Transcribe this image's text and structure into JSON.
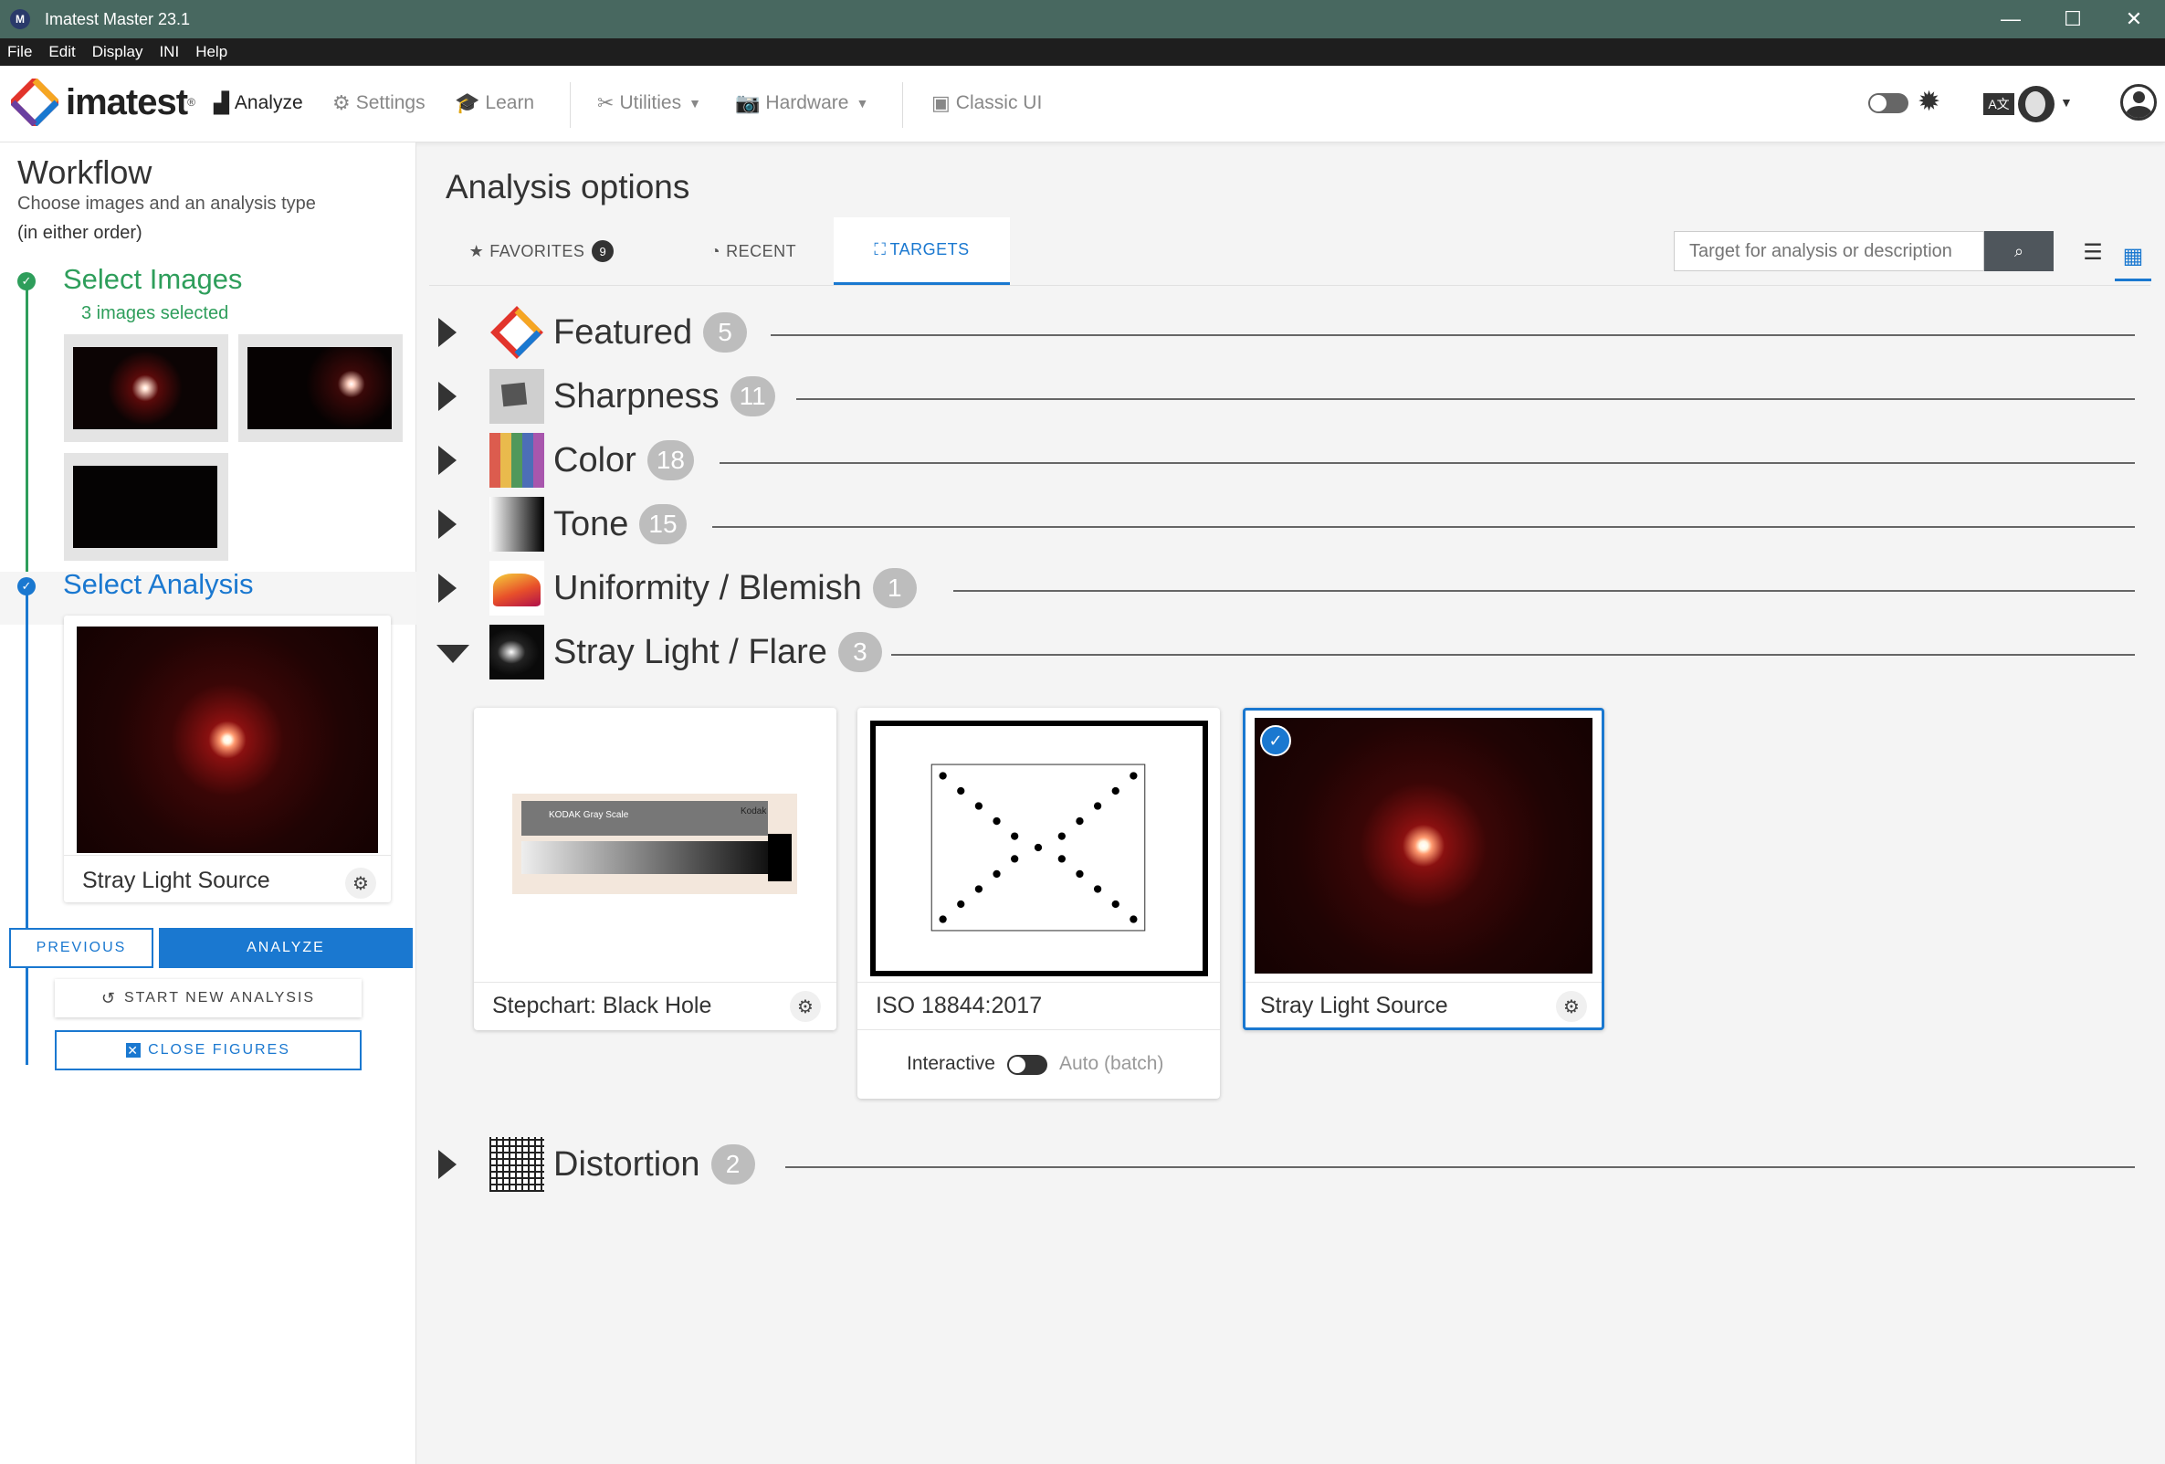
{
  "window": {
    "title": "Imatest Master 23.1",
    "app_icon": "M",
    "minimize": "—",
    "maximize": "☐",
    "close": "✕"
  },
  "menu": [
    "File",
    "Edit",
    "Display",
    "INI",
    "Help"
  ],
  "toolbar": {
    "logo_text": "imatest",
    "logo_reg": "®",
    "analyze": "Analyze",
    "settings": "Settings",
    "learn": "Learn",
    "utilities": "Utilities",
    "hardware": "Hardware",
    "classic_ui": "Classic UI",
    "lang_icon": "A文"
  },
  "workflow": {
    "title": "Workflow",
    "subtitle": "Choose images and an analysis type",
    "subtitle2": "(in either order)",
    "step1": {
      "title": "Select Images",
      "status": "3 images selected",
      "color": "#2e9e5b"
    },
    "step2": {
      "title": "Select Analysis",
      "color": "#1a78d0"
    },
    "selected_analysis": "Stray Light Source",
    "previous": "PREVIOUS",
    "analyze": "ANALYZE",
    "start_new": "START NEW ANALYSIS",
    "close_figures": "CLOSE FIGURES"
  },
  "main": {
    "title": "Analysis options",
    "tabs": {
      "favorites": "FAVORITES",
      "favorites_count": "9",
      "recent": "RECENT",
      "targets": "TARGETS"
    },
    "search_placeholder": "Target for analysis or description",
    "categories": {
      "featured": {
        "label": "Featured",
        "count": "5"
      },
      "sharpness": {
        "label": "Sharpness",
        "count": "11"
      },
      "color": {
        "label": "Color",
        "count": "18"
      },
      "tone": {
        "label": "Tone",
        "count": "15"
      },
      "uniformity": {
        "label": "Uniformity / Blemish",
        "count": "1"
      },
      "stray": {
        "label": "Stray Light / Flare",
        "count": "3"
      },
      "distortion": {
        "label": "Distortion",
        "count": "2"
      }
    },
    "stray_cards": {
      "stepchart": {
        "caption": "Stepchart: Black Hole",
        "chart_title": "KODAK Gray Scale",
        "brand": "Kodak"
      },
      "iso": {
        "caption": "ISO 18844:2017",
        "mode_interactive": "Interactive",
        "mode_auto": "Auto (batch)"
      },
      "source": {
        "caption": "Stray Light Source"
      }
    }
  },
  "colors": {
    "accent": "#1a78d0",
    "success": "#2e9e5b",
    "titlebar": "#486860"
  }
}
